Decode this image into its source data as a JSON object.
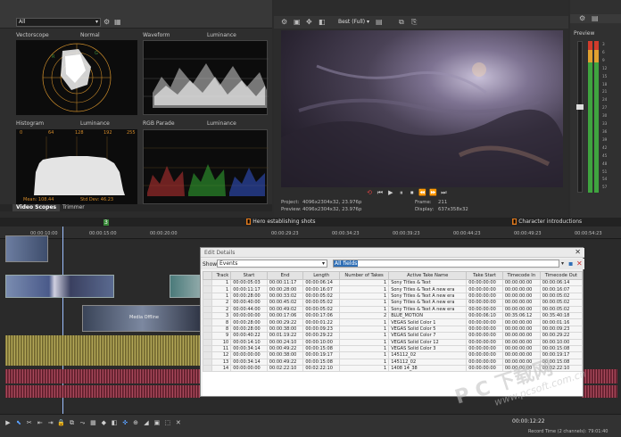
{
  "scopes": {
    "dropdown_value": "All",
    "vectorscope_label": "Vectorscope",
    "vectorscope_mode": "Normal",
    "waveform_label": "Waveform",
    "waveform_mode": "Luminance",
    "histogram_label": "Histogram",
    "histogram_mode": "Luminance",
    "histogram_ticks": [
      "0",
      "64",
      "128",
      "192",
      "255"
    ],
    "histogram_stats": "Mean: 108.44",
    "histogram_stddev": "Std Dev: 46.23",
    "parade_label": "RGB Parade",
    "parade_mode": "Luminance",
    "tab_video_scopes": "Video Scopes",
    "tab_trimmer": "Trimmer"
  },
  "preview": {
    "quality": "Best (Full)",
    "project_label": "Project:",
    "project_value": "4096x2304x32, 23.976p",
    "preview_label": "Preview:",
    "preview_value": "4096x2304x32, 23.976p",
    "frame_label": "Frame:",
    "frame_value": "211",
    "display_label": "Display:",
    "display_value": "637x358x32",
    "side_label": "Preview"
  },
  "meters": {
    "scale": [
      "3",
      "6",
      "9",
      "12",
      "15",
      "18",
      "21",
      "24",
      "27",
      "30",
      "33",
      "36",
      "39",
      "42",
      "45",
      "48",
      "51",
      "54",
      "57"
    ]
  },
  "timeline": {
    "markers": [
      {
        "label": "Hero establishing shots"
      },
      {
        "label": "Character introductions"
      }
    ],
    "marker_num": "3",
    "ruler": [
      "00:00:10:00",
      "00:00:15:00",
      "00:00:20:00",
      "00:00:29:23",
      "00:00:34:23",
      "00:00:39:23",
      "00:00:44:23",
      "00:00:49:23",
      "00:00:54:23"
    ],
    "timecode": "00:00:12:22",
    "record_time": "Record Time (2 channels): 79:01:40",
    "clip_label": "Media Offline"
  },
  "edit_details": {
    "title": "Edit Details",
    "show_label": "Show:",
    "show_value": "Events",
    "filter_value": "All fields",
    "columns": [
      "Track",
      "Start",
      "End",
      "Length",
      "Number of Takes",
      "Active Take Name",
      "Take Start",
      "Timecode In",
      "Timecode Out"
    ],
    "rows": [
      [
        "1",
        "00:00:05:03",
        "00:00:11:17",
        "00:00:06:14",
        "1",
        "Sony Titles & Text",
        "00:00:00:00",
        "00:00:00:00",
        "00:00:06:14"
      ],
      [
        "1",
        "00:00:11:17",
        "00:00:28:00",
        "00:00:16:07",
        "1",
        "Sony Titles & Text A new era",
        "00:00:00:00",
        "00:00:00:00",
        "00:00:16:07"
      ],
      [
        "1",
        "00:00:28:00",
        "00:00:33:02",
        "00:00:05:02",
        "1",
        "Sony Titles & Text A new era",
        "00:00:00:00",
        "00:00:00:00",
        "00:00:05:02"
      ],
      [
        "2",
        "00:00:40:00",
        "00:00:45:02",
        "00:00:05:02",
        "1",
        "Sony Titles & Text A new era",
        "00:00:00:00",
        "00:00:00:00",
        "00:00:05:02"
      ],
      [
        "2",
        "00:00:44:00",
        "00:00:49:02",
        "00:00:05:02",
        "1",
        "Sony Titles & Text A new era",
        "00:00:00:00",
        "00:00:00:00",
        "00:00:05:02"
      ],
      [
        "3",
        "00:00:00:00",
        "00:00:17:06",
        "00:00:17:06",
        "2",
        "BLUE_MOTION",
        "00:00:06:10",
        "00:35:06:12",
        "00:35:40:18"
      ],
      [
        "8",
        "00:00:28:00",
        "00:00:29:22",
        "00:00:01:22",
        "1",
        "VEGAS Solid Color 1",
        "00:00:00:00",
        "00:00:00:00",
        "00:00:01:16"
      ],
      [
        "8",
        "00:00:28:00",
        "00:00:38:00",
        "00:00:09:23",
        "1",
        "VEGAS Solid Color 5",
        "00:00:00:00",
        "00:00:00:00",
        "00:00:09:23"
      ],
      [
        "9",
        "00:00:40:22",
        "00:01:19:22",
        "00:00:29:22",
        "1",
        "VEGAS Solid Color 7",
        "00:00:00:00",
        "00:00:00:00",
        "00:00:29:22"
      ],
      [
        "10",
        "00:00:14:10",
        "00:00:24:10",
        "00:00:10:00",
        "1",
        "VEGAS Solid Color 12",
        "00:00:00:00",
        "00:00:00:00",
        "00:00:10:00"
      ],
      [
        "11",
        "00:00:34:14",
        "00:00:49:22",
        "00:00:15:08",
        "1",
        "VEGAS Solid Color 3",
        "00:00:00:00",
        "00:00:00:00",
        "00:00:15:08"
      ],
      [
        "12",
        "00:00:00:00",
        "00:00:38:00",
        "00:00:19:17",
        "1",
        "145112_02",
        "00:00:00:00",
        "00:00:00:00",
        "00:00:19:17"
      ],
      [
        "13",
        "00:00:34:14",
        "00:00:49:22",
        "00:00:15:08",
        "1",
        "145112_02",
        "00:00:00:00",
        "00:00:00:00",
        "00:00:15:08"
      ],
      [
        "14",
        "00:00:00:00",
        "00:02:22:10",
        "00:02:22:10",
        "1",
        "1408 14_38",
        "00:00:00:00",
        "00:00:00:00",
        "00:02:22:10"
      ]
    ]
  },
  "watermark": {
    "text": "P C 下载网",
    "url": "www.pcsoft.com.cn"
  },
  "colors": {
    "accent": "#2f6fb6",
    "marker": "#e07a1e",
    "audio_top": "#9e9248",
    "audio_bottom": "#8a3346"
  }
}
